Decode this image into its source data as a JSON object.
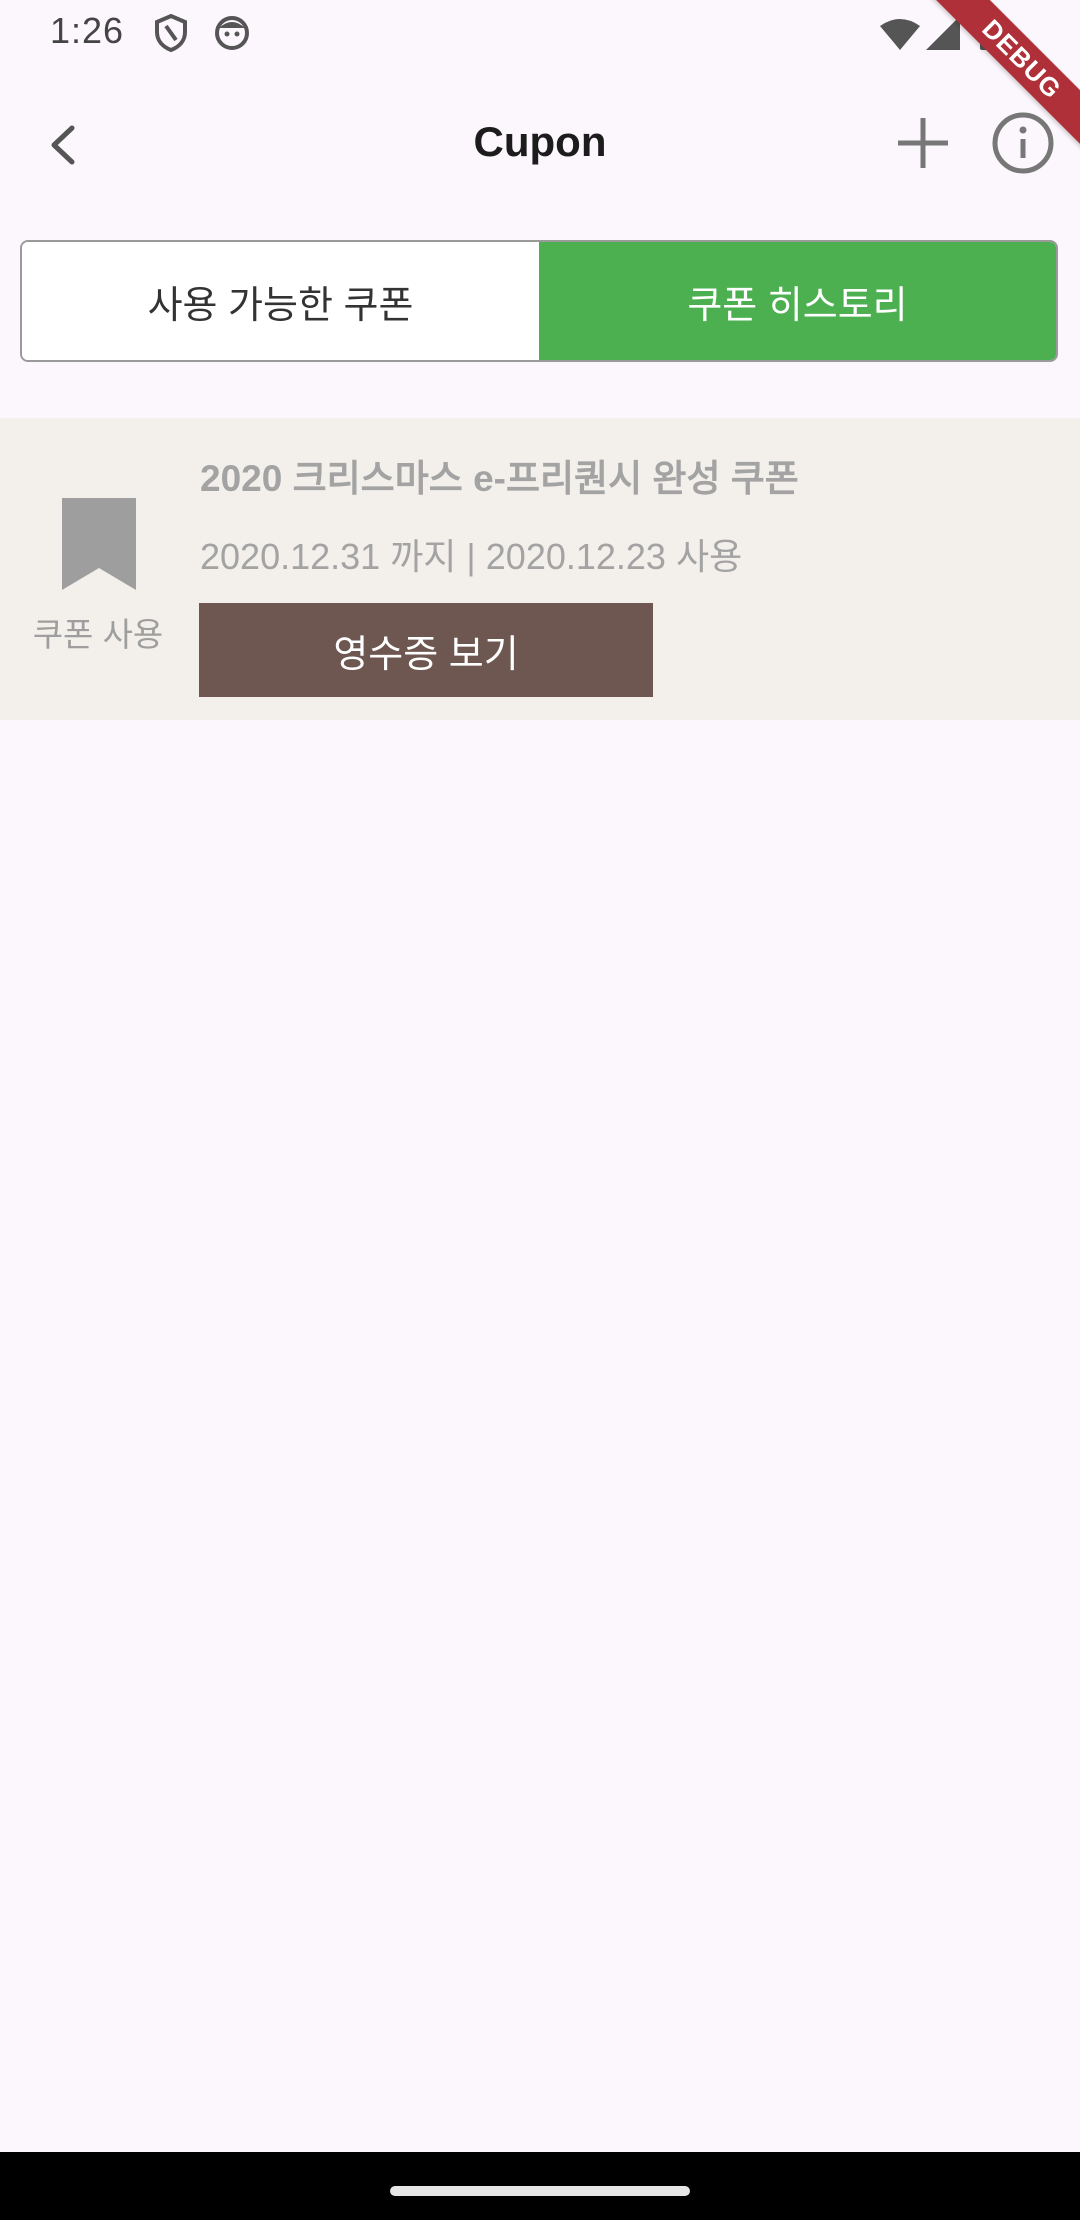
{
  "status_bar": {
    "time": "1:26",
    "icons": [
      "shield-icon",
      "face-icon",
      "wifi-icon",
      "signal-icon",
      "battery-icon"
    ],
    "debug_label": "DEBUG"
  },
  "app_bar": {
    "title": "Cupon",
    "back_icon": "chevron-left-icon",
    "add_icon": "plus-icon",
    "info_icon": "info-icon"
  },
  "tabs": {
    "available": "사용 가능한 쿠폰",
    "history": "쿠폰 히스토리",
    "selected": "history",
    "selected_color": "#4CAF50"
  },
  "coupons": [
    {
      "icon": "bookmark-icon",
      "status_label": "쿠폰 사용",
      "title": "2020 크리스마스 e-프리퀀시 완성 쿠폰",
      "dates": "2020.12.31 까지 | 2020.12.23 사용",
      "button_label": "영수증 보기",
      "button_color": "#6D5750"
    }
  ]
}
